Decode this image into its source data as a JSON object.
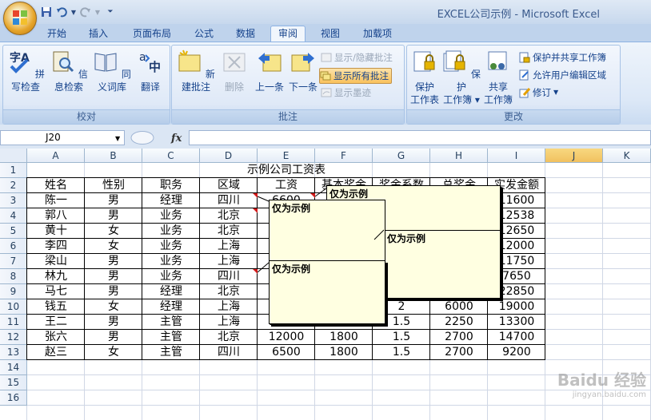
{
  "window": {
    "title": "EXCEL公司示例 - Microsoft Excel"
  },
  "ribbon_tabs": [
    "开始",
    "插入",
    "页面布局",
    "公式",
    "数据",
    "审阅",
    "视图",
    "加载项"
  ],
  "active_tab": "审阅",
  "groups": {
    "proofing": {
      "label": "校对",
      "buttons": [
        "拼写检查",
        "信息检索",
        "同义词库",
        "翻译"
      ]
    },
    "comments": {
      "label": "批注",
      "new": "新建批注",
      "delete": "删除",
      "prev": "上一条",
      "next": "下一条",
      "show_hide": "显示/隐藏批注",
      "show_all": "显示所有批注",
      "show_ink": "显示墨迹"
    },
    "changes": {
      "label": "更改",
      "protect_sheet": [
        "保护",
        "工作表"
      ],
      "protect_workbook": [
        "保护",
        "工作簿"
      ],
      "share_workbook": [
        "共享",
        "工作簿"
      ],
      "protect_share": "保护并共享工作簿",
      "allow_edit": "允许用户编辑区域",
      "track": "修订"
    }
  },
  "formula_bar": {
    "name_box": "J20",
    "fx": "fx",
    "formula": ""
  },
  "sheet": {
    "columns": [
      "A",
      "B",
      "C",
      "D",
      "E",
      "F",
      "G",
      "H",
      "I",
      "J",
      "K"
    ],
    "selected_column": "J",
    "rows": [
      "1",
      "2",
      "3",
      "4",
      "5",
      "6",
      "7",
      "8",
      "9",
      "10",
      "11",
      "12",
      "13",
      "14",
      "15",
      "16"
    ],
    "title": "示例公司工资表",
    "headers": [
      "姓名",
      "性别",
      "职务",
      "区域",
      "工资",
      "基本奖金",
      "奖金系数",
      "总奖金",
      "实发金额"
    ],
    "data": [
      [
        "陈一",
        "男",
        "经理",
        "四川",
        "6600",
        "",
        "",
        "",
        "11600"
      ],
      [
        "郭八",
        "男",
        "业务",
        "北京",
        "",
        "",
        "",
        "",
        "12538"
      ],
      [
        "黄十",
        "女",
        "业务",
        "北京",
        "",
        "",
        "",
        "",
        "12650"
      ],
      [
        "李四",
        "女",
        "业务",
        "上海",
        "",
        "",
        "",
        "",
        "12000"
      ],
      [
        "梁山",
        "男",
        "业务",
        "上海",
        "",
        "",
        "",
        "",
        "11750"
      ],
      [
        "林九",
        "男",
        "业务",
        "四川",
        "",
        "",
        "",
        "",
        "7650"
      ],
      [
        "马七",
        "男",
        "经理",
        "北京",
        "",
        "",
        "",
        "",
        "22850"
      ],
      [
        "钱五",
        "女",
        "经理",
        "上海",
        "",
        "",
        "2",
        "6000",
        "19000"
      ],
      [
        "王二",
        "男",
        "主管",
        "上海",
        "11000",
        "1800",
        "1.5",
        "2250",
        "13300"
      ],
      [
        "张六",
        "男",
        "主管",
        "北京",
        "12000",
        "1800",
        "1.5",
        "2700",
        "14700"
      ],
      [
        "赵三",
        "女",
        "主管",
        "四川",
        "6500",
        "1800",
        "1.5",
        "2700",
        "9200"
      ]
    ],
    "comment_text": "仅为示例"
  },
  "watermark": {
    "main": "Baidu 经验",
    "sub": "jingyan.baidu.com"
  }
}
